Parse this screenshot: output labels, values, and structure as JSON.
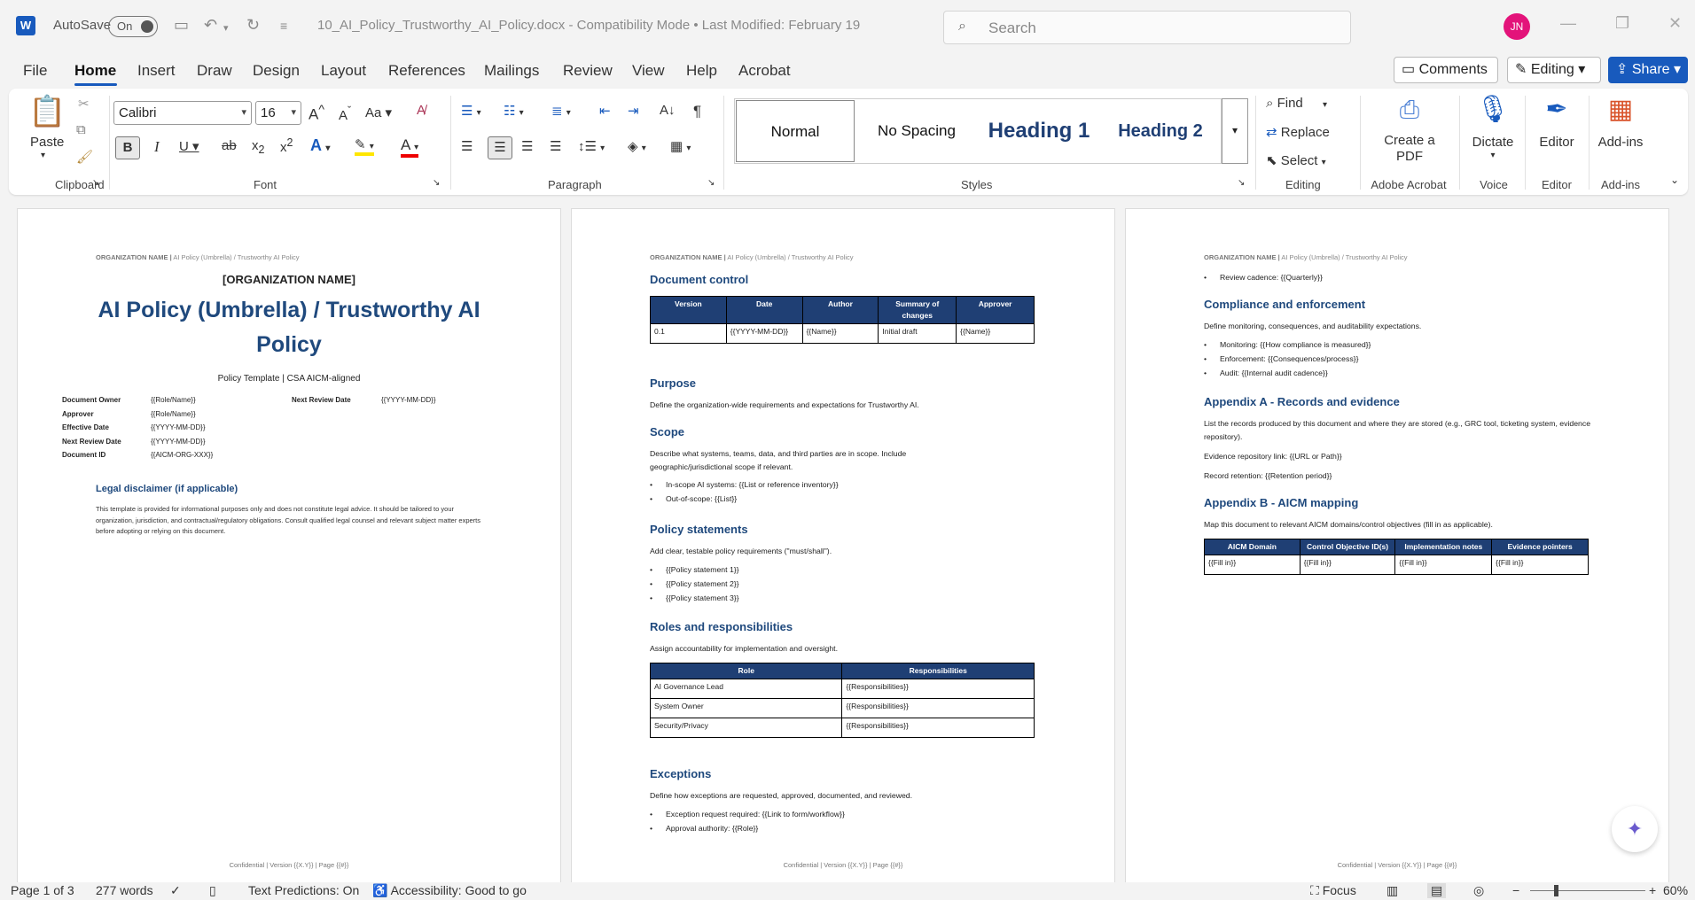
{
  "titlebar": {
    "autosave_label": "AutoSave",
    "autosave_state": "On",
    "doc_title": "10_AI_Policy_Trustworthy_AI_Policy.docx  -  Compatibility Mode  •  Last Modified: February 19",
    "search_placeholder": "Search",
    "avatar_initials": "JN"
  },
  "menu": {
    "tabs": [
      "File",
      "Home",
      "Insert",
      "Draw",
      "Design",
      "Layout",
      "References",
      "Mailings",
      "Review",
      "View",
      "Help",
      "Acrobat"
    ],
    "comments_label": "Comments",
    "editing_label": "Editing",
    "share_label": "Share"
  },
  "ribbon": {
    "paste_label": "Paste",
    "font_name": "Calibri",
    "font_size": "16",
    "styles": [
      "Normal",
      "No Spacing",
      "Heading 1",
      "Heading 2"
    ],
    "find_label": "Find",
    "replace_label": "Replace",
    "select_label": "Select",
    "create_pdf_label": "Create a PDF",
    "dictate_label": "Dictate",
    "editor_label": "Editor",
    "addins_label": "Add-ins",
    "groups": {
      "clipboard": "Clipboard",
      "font": "Font",
      "paragraph": "Paragraph",
      "styles": "Styles",
      "editing": "Editing",
      "adobe": "Adobe Acrobat",
      "voice": "Voice",
      "editor": "Editor",
      "addins": "Add-ins"
    }
  },
  "doc": {
    "header_org": "ORGANIZATION NAME |",
    "header_title": "AI Policy (Umbrella) / Trustworthy AI Policy",
    "footer": "Confidential | Version {{X.Y}} | Page {{#}}",
    "page1": {
      "org": "[ORGANIZATION NAME]",
      "title_line1": "AI Policy (Umbrella) / Trustworthy AI",
      "title_line2": "Policy",
      "subtitle": "Policy Template | CSA AICM-aligned",
      "meta": [
        {
          "label": "Document Owner",
          "value": "{{Role/Name}}"
        },
        {
          "label": "Approver",
          "value": "{{Role/Name}}"
        },
        {
          "label": "Effective Date",
          "value": "{{YYYY-MM-DD}}"
        },
        {
          "label": "Next Review Date",
          "value": "{{YYYY-MM-DD}}"
        },
        {
          "label": "Document ID",
          "value": "{{AICM-ORG-XXX}}"
        }
      ],
      "meta_right_label": "Next Review Date",
      "meta_right_value": "{{YYYY-MM-DD}}",
      "disclaimer_heading": "Legal disclaimer (if applicable)",
      "disclaimer_text": "This template is provided for informational purposes only and does not constitute legal advice. It should be tailored to your organization, jurisdiction, and contractual/regulatory obligations. Consult qualified legal counsel and relevant subject matter experts before adopting or relying on this document."
    },
    "page2": {
      "doc_control_heading": "Document control",
      "doc_control_headers": [
        "Version",
        "Date",
        "Author",
        "Summary of changes",
        "Approver"
      ],
      "doc_control_row": [
        "0.1",
        "{{YYYY-MM-DD}}",
        "{{Name}}",
        "Initial draft",
        "{{Name}}"
      ],
      "purpose_heading": "Purpose",
      "purpose_text": "Define the organization-wide requirements and expectations for Trustworthy AI.",
      "scope_heading": "Scope",
      "scope_text": "Describe what systems, teams, data, and third parties are in scope. Include geographic/jurisdictional scope if relevant.",
      "scope_bullets": [
        "In-scope AI systems: {{List or reference inventory}}",
        "Out-of-scope: {{List}}"
      ],
      "policy_heading": "Policy statements",
      "policy_text": "Add clear, testable policy requirements (\"must/shall\").",
      "policy_bullets": [
        "{{Policy statement 1}}",
        "{{Policy statement 2}}",
        "{{Policy statement 3}}"
      ],
      "roles_heading": "Roles and responsibilities",
      "roles_text": "Assign accountability for implementation and oversight.",
      "roles_headers": [
        "Role",
        "Responsibilities"
      ],
      "roles_rows": [
        [
          "AI Governance Lead",
          "{{Responsibilities}}"
        ],
        [
          "System Owner",
          "{{Responsibilities}}"
        ],
        [
          "Security/Privacy",
          "{{Responsibilities}}"
        ]
      ],
      "exceptions_heading": "Exceptions",
      "exceptions_text": "Define how exceptions are requested, approved, documented, and reviewed.",
      "exceptions_bullets": [
        "Exception request required: {{Link to form/workflow}}",
        "Approval authority: {{Role}}"
      ]
    },
    "page3": {
      "review_bullet": "Review cadence: {{Quarterly}}",
      "compliance_heading": "Compliance and enforcement",
      "compliance_text": "Define monitoring, consequences, and auditability expectations.",
      "compliance_bullets": [
        "Monitoring: {{How compliance is measured}}",
        "Enforcement: {{Consequences/process}}",
        "Audit: {{Internal audit cadence}}"
      ],
      "appA_heading": "Appendix A - Records and evidence",
      "appA_text": "List the records produced by this document and where they are stored (e.g., GRC tool, ticketing system, evidence repository).",
      "appA_link": "Evidence repository link: {{URL or Path}}",
      "appA_retention": "Record retention: {{Retention period}}",
      "appB_heading": "Appendix B - AICM mapping",
      "appB_text": "Map this document to relevant AICM domains/control objectives (fill in as applicable).",
      "appB_headers": [
        "AICM Domain",
        "Control Objective ID(s)",
        "Implementation notes",
        "Evidence pointers"
      ],
      "appB_row": [
        "{{Fill in}}",
        "{{Fill in}}",
        "{{Fill in}}",
        "{{Fill in}}"
      ]
    }
  },
  "status": {
    "page": "Page 1 of 3",
    "words": "277 words",
    "text_predictions": "Text Predictions: On",
    "accessibility": "Accessibility: Good to go",
    "focus": "Focus",
    "zoom": "60%"
  },
  "colors": {
    "accent": "#185abd",
    "heading": "#1f497d",
    "table_header": "#1f3f74"
  }
}
